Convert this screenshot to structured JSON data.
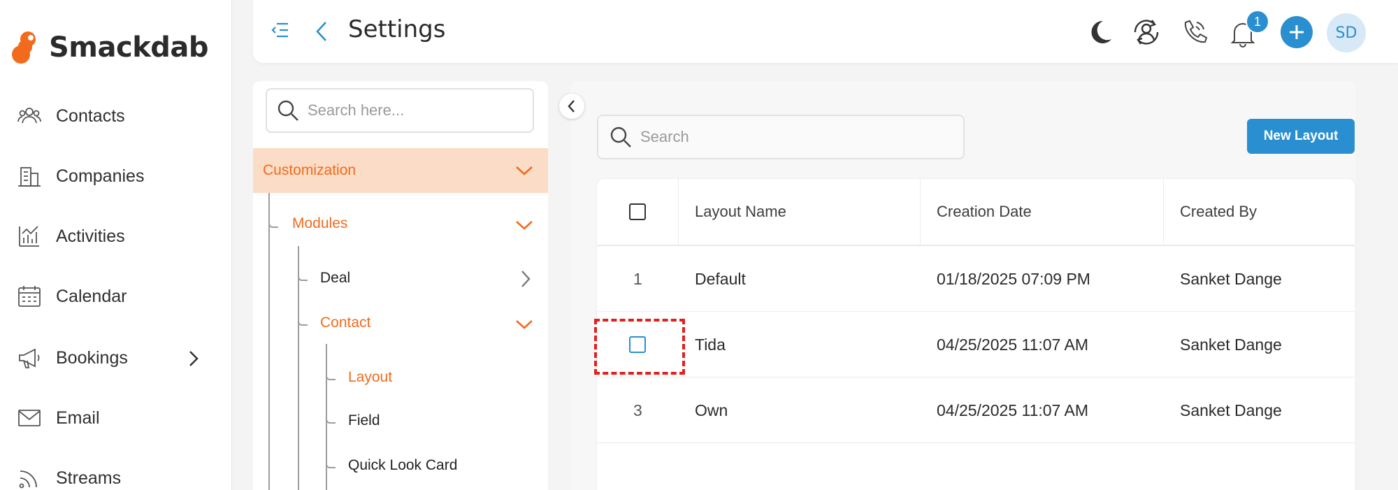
{
  "app": {
    "name": "Smackdab"
  },
  "sidebar": {
    "items": [
      {
        "label": "Contacts"
      },
      {
        "label": "Companies"
      },
      {
        "label": "Activities"
      },
      {
        "label": "Calendar"
      },
      {
        "label": "Bookings"
      },
      {
        "label": "Email"
      },
      {
        "label": "Streams"
      }
    ]
  },
  "header": {
    "title": "Settings",
    "notification_count": "1",
    "avatar_initials": "SD"
  },
  "tree": {
    "search_placeholder": "Search here...",
    "section": "Customization",
    "modules": "Modules",
    "deal": "Deal",
    "contact": "Contact",
    "layout": "Layout",
    "field": "Field",
    "quick_look_card": "Quick Look Card"
  },
  "main": {
    "search_placeholder": "Search",
    "new_layout_label": "New Layout",
    "columns": [
      "Layout Name",
      "Creation Date",
      "Created By"
    ],
    "rows": [
      {
        "index": "1",
        "name": "Default",
        "date": "01/18/2025 07:09 PM",
        "created_by": "Sanket Dange"
      },
      {
        "index": "",
        "name": "Tida",
        "date": "04/25/2025 11:07 AM",
        "created_by": "Sanket Dange"
      },
      {
        "index": "3",
        "name": "Own",
        "date": "04/25/2025 11:07 AM",
        "created_by": "Sanket Dange"
      }
    ]
  },
  "colors": {
    "accent_blue": "#2a8fd0",
    "accent_orange": "#f26b1d",
    "section_highlight": "#fbdcc6",
    "highlight_box": "#e31e1e"
  }
}
